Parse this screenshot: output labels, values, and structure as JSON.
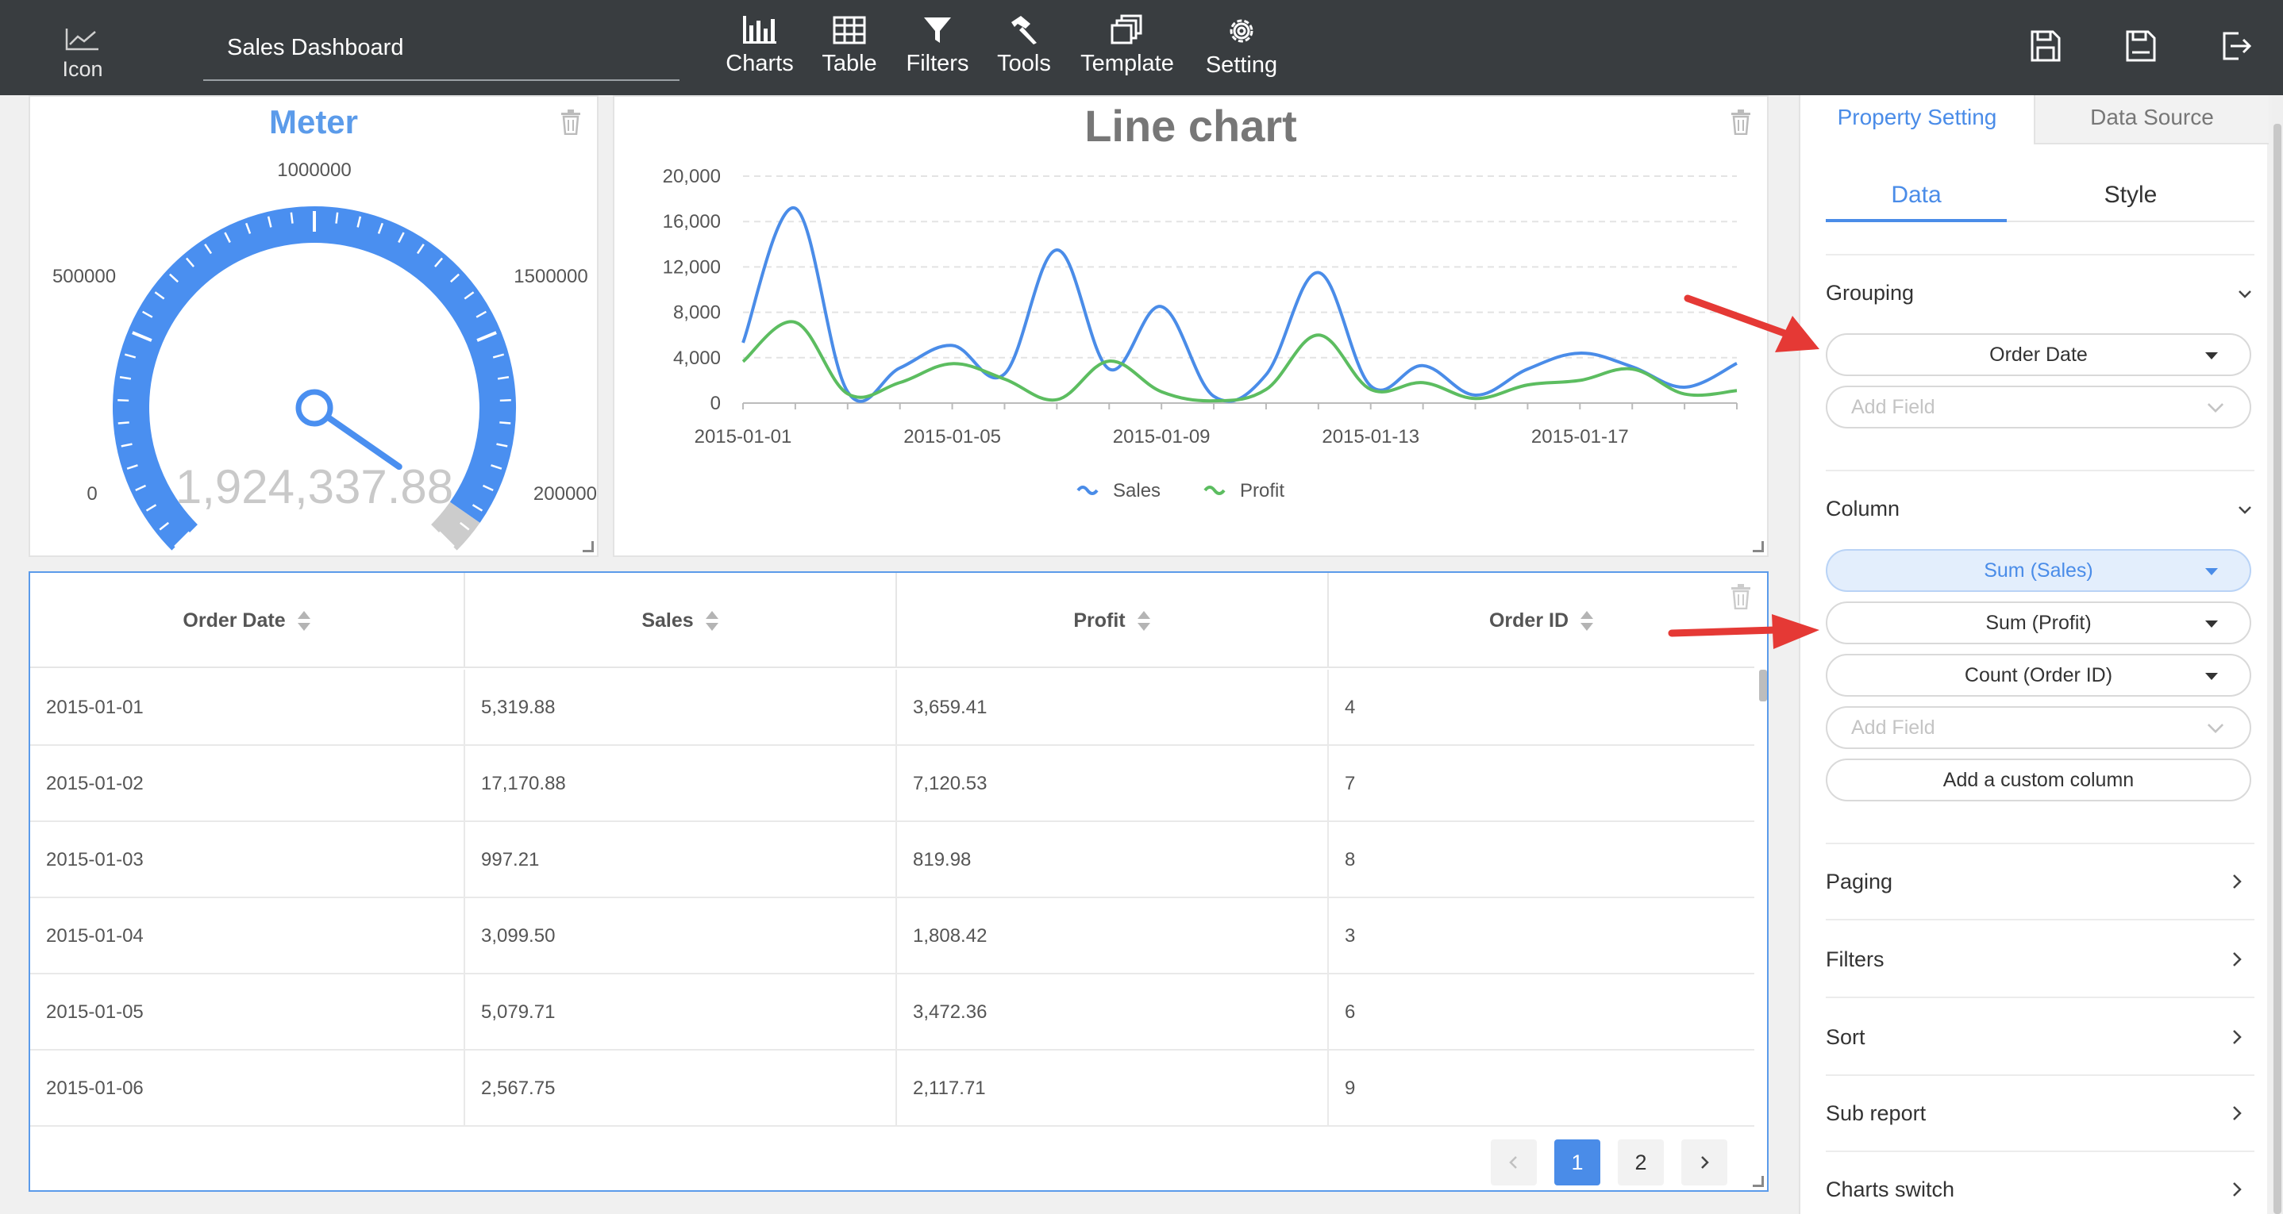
{
  "app": {
    "brand_label": "Icon",
    "dashboard_title": "Sales Dashboard"
  },
  "toolbar": {
    "items": [
      {
        "label": "Charts",
        "icon": "bar-chart-icon"
      },
      {
        "label": "Table",
        "icon": "table-icon"
      },
      {
        "label": "Filters",
        "icon": "filter-icon"
      },
      {
        "label": "Tools",
        "icon": "hammer-icon"
      },
      {
        "label": "Template",
        "icon": "template-icon"
      },
      {
        "label": "Setting",
        "icon": "gear-icon"
      }
    ],
    "right_icons": [
      "save-icon",
      "save-as-icon",
      "exit-icon"
    ]
  },
  "gauge": {
    "title": "Meter",
    "labels": [
      "0",
      "500000",
      "1000000",
      "1500000",
      "200000"
    ],
    "value_text": "1,924,337.88",
    "min": 0,
    "max": 2000000,
    "value": 1924337.88,
    "color": "#4a8ff0"
  },
  "chart_data": {
    "type": "line",
    "title": "Line chart",
    "xlabel": "",
    "ylabel": "",
    "x": [
      "2015-01-01",
      "2015-01-02",
      "2015-01-03",
      "2015-01-04",
      "2015-01-05",
      "2015-01-06",
      "2015-01-07",
      "2015-01-08",
      "2015-01-09",
      "2015-01-10",
      "2015-01-11",
      "2015-01-12",
      "2015-01-13",
      "2015-01-14",
      "2015-01-15",
      "2015-01-16",
      "2015-01-17",
      "2015-01-18",
      "2015-01-19",
      "2015-01-20"
    ],
    "x_tick_labels": [
      "2015-01-01",
      "2015-01-05",
      "2015-01-09",
      "2015-01-13",
      "2015-01-17"
    ],
    "y_tick_labels": [
      "0",
      "4,000",
      "8,000",
      "12,000",
      "16,000",
      "20,000"
    ],
    "ylim": [
      0,
      20000
    ],
    "grid": true,
    "legend": "bottom",
    "series": [
      {
        "name": "Sales",
        "color": "#4a8ce8",
        "values": [
          5319.88,
          17170.88,
          997.21,
          3099.5,
          5079.71,
          2567.75,
          13500,
          3000,
          8500,
          600,
          2500,
          11500,
          1500,
          3300,
          700,
          3000,
          4400,
          3200,
          1400,
          3500
        ]
      },
      {
        "name": "Profit",
        "color": "#5cbd60",
        "values": [
          3659.41,
          7120.53,
          819.98,
          1808.42,
          3472.36,
          2117.71,
          300,
          3700,
          1000,
          200,
          1200,
          6000,
          1200,
          1800,
          400,
          1600,
          2000,
          3000,
          800,
          1100
        ]
      }
    ]
  },
  "table": {
    "columns": [
      "Order Date",
      "Sales",
      "Profit",
      "Order ID"
    ],
    "rows": [
      [
        "2015-01-01",
        "5,319.88",
        "3,659.41",
        "4"
      ],
      [
        "2015-01-02",
        "17,170.88",
        "7,120.53",
        "7"
      ],
      [
        "2015-01-03",
        "997.21",
        "819.98",
        "8"
      ],
      [
        "2015-01-04",
        "3,099.50",
        "1,808.42",
        "3"
      ],
      [
        "2015-01-05",
        "5,079.71",
        "3,472.36",
        "6"
      ],
      [
        "2015-01-06",
        "2,567.75",
        "2,117.71",
        "9"
      ]
    ],
    "pages": [
      "1",
      "2"
    ],
    "current_page": "1"
  },
  "side": {
    "tabs": [
      "Property Setting",
      "Data Source"
    ],
    "subtabs": [
      "Data",
      "Style"
    ],
    "grouping": {
      "title": "Grouping",
      "fields": [
        "Order Date"
      ],
      "add_placeholder": "Add Field"
    },
    "column": {
      "title": "Column",
      "fields": [
        "Sum (Sales)",
        "Sum (Profit)",
        "Count (Order ID)"
      ],
      "add_placeholder": "Add Field",
      "custom_label": "Add a custom column"
    },
    "items": [
      "Paging",
      "Filters",
      "Sort",
      "Sub report",
      "Charts switch"
    ]
  },
  "colors": {
    "accent": "#4a8ce8",
    "topbar": "#393d40",
    "annotation_arrow": "#e53935"
  }
}
